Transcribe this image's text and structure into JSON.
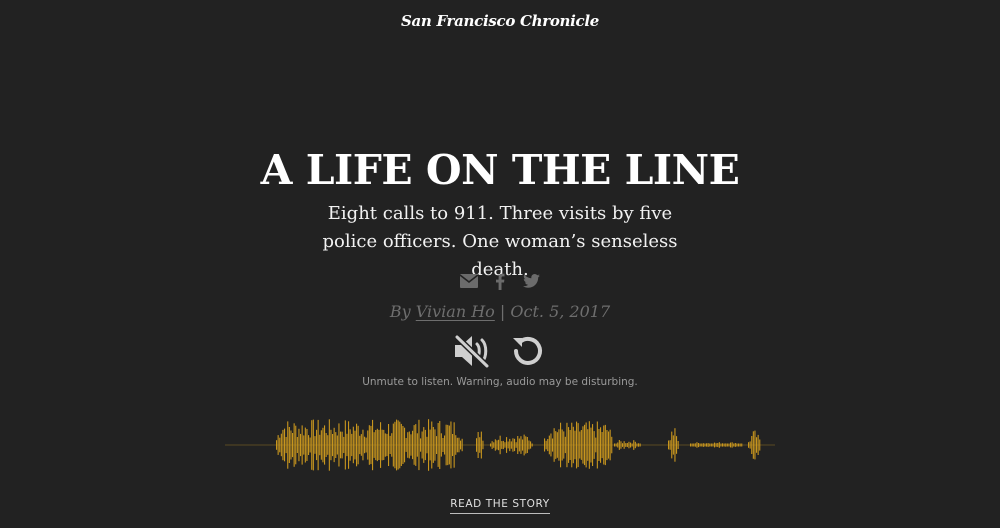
{
  "masthead": "San Francisco Chronicle",
  "headline": "A LIFE ON THE LINE",
  "dek": "Eight calls to 911. Three visits by five police officers. One woman’s senseless death.",
  "share": {
    "icons": [
      "email-icon",
      "facebook-icon",
      "twitter-icon"
    ],
    "color": "#6b6b6b"
  },
  "byline": {
    "prefix": "By",
    "author": "Vivian Ho",
    "separator": "|",
    "date": "Oct. 5, 2017"
  },
  "controls": {
    "icons": [
      "muted-speaker-icon",
      "replay-icon"
    ],
    "color": "#cfcfcf"
  },
  "hint": "Unmute to listen. Warning, audio may be disturbing.",
  "waveform": {
    "color": "#c8961e",
    "baseline_color": "#5a4a22"
  },
  "cta": "READ THE STORY",
  "colors": {
    "background": "#222222",
    "text": "#ffffff",
    "muted": "#6e6e6e"
  }
}
